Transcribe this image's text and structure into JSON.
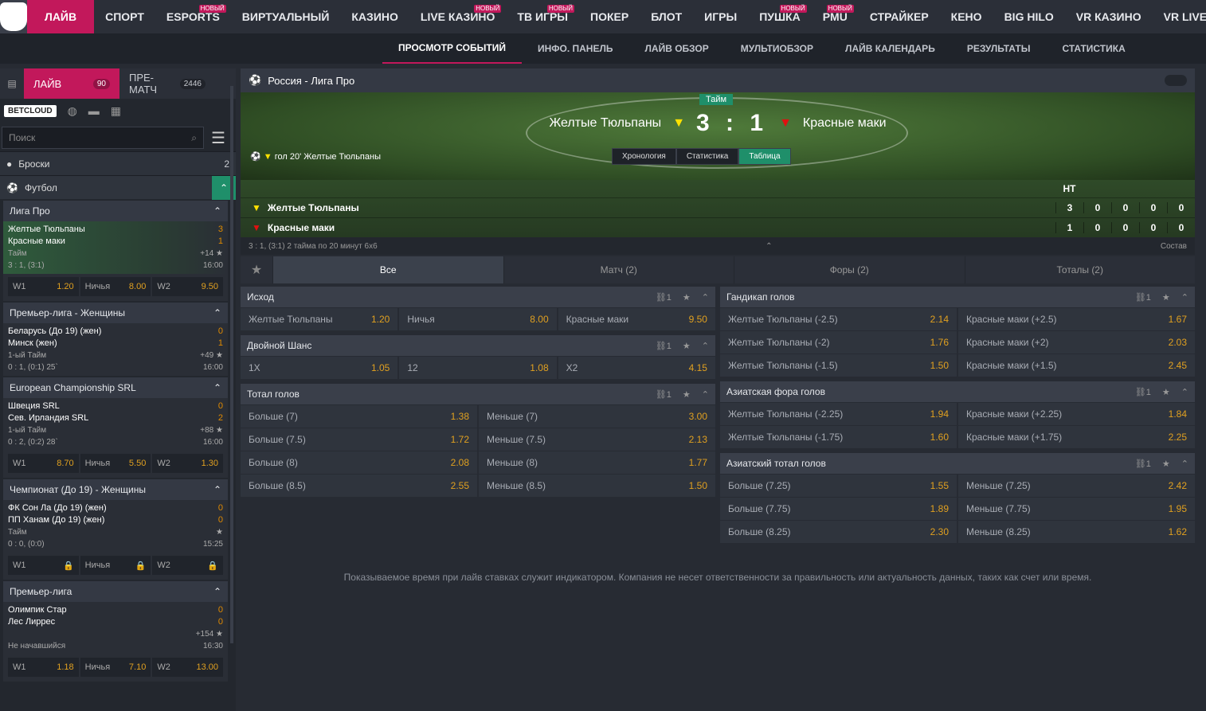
{
  "nav": {
    "items": [
      "ЛАЙВ",
      "СПОРТ",
      "ESPORTS",
      "ВИРТУАЛЬНЫЙ",
      "КАЗИНО",
      "LIVE КАЗИНО",
      "ТВ ИГРЫ",
      "ПОКЕР",
      "БЛОТ",
      "ИГРЫ",
      "ПУШКА",
      "PMU",
      "СТРАЙКЕР",
      "КЕНО",
      "BIG HILO",
      "VR КАЗИНО",
      "VR LIVE"
    ],
    "new_badge": "НОВЫЙ"
  },
  "subnav": {
    "items": [
      "ПРОСМОТР СОБЫТИЙ",
      "ИНФО. ПАНЕЛЬ",
      "ЛАЙВ ОБЗОР",
      "МУЛЬТИОБЗОР",
      "ЛАЙВ КАЛЕНДАРЬ",
      "РЕЗУЛЬТАТЫ",
      "СТАТИСТИКА"
    ]
  },
  "sidebar": {
    "live_label": "ЛАЙВ",
    "live_count": "90",
    "prematch_label": "ПРЕ-МАТЧ",
    "prematch_count": "2446",
    "betcloud": "BETCLOUD",
    "search_placeholder": "Поиск",
    "sports": [
      {
        "name": "Броски",
        "count": "2"
      },
      {
        "name": "Футбол"
      }
    ],
    "leagues": [
      {
        "name": "Лига Про",
        "t1": "Желтые Тюльпаны",
        "s1": "3",
        "t2": "Красные маки",
        "s2": "1",
        "status": "Тайм",
        "extra": "+14",
        "score": "3 : 1, (3:1)",
        "time": "16:00",
        "odds": [
          [
            "W1",
            "1.20"
          ],
          [
            "Ничья",
            "8.00"
          ],
          [
            "W2",
            "9.50"
          ]
        ]
      },
      {
        "name": "Премьер-лига - Женщины",
        "t1": "Беларусь (До 19) (жен)",
        "s1": "0",
        "t2": "Минск (жен)",
        "s2": "1",
        "status": "1-ый Тайм",
        "extra": "+49",
        "score": "0 : 1, (0:1) 25`",
        "time": "16:00"
      },
      {
        "name": "European Championship SRL",
        "t1": "Швеция SRL",
        "s1": "0",
        "t2": "Сев. Ирландия SRL",
        "s2": "2",
        "status": "1-ый Тайм",
        "extra": "+88",
        "score": "0 : 2, (0:2) 28`",
        "time": "16:00",
        "odds": [
          [
            "W1",
            "8.70"
          ],
          [
            "Ничья",
            "5.50"
          ],
          [
            "W2",
            "1.30"
          ]
        ]
      },
      {
        "name": "Чемпионат (До 19) - Женщины",
        "t1": "ФК Сон Ла (До 19) (жен)",
        "s1": "0",
        "t2": "ПП Ханам (До 19) (жен)",
        "s2": "0",
        "status": "Тайм",
        "extra": "",
        "score": "0 : 0, (0:0)",
        "time": "15:25",
        "odds": [
          [
            "W1",
            ""
          ],
          [
            "Ничья",
            ""
          ],
          [
            "W2",
            ""
          ]
        ]
      },
      {
        "name": "Премьер-лига",
        "t1": "Олимпик Стар",
        "s1": "0",
        "t2": "Лес Лиррес",
        "s2": "0",
        "status": "",
        "extra": "+154",
        "score": "Не начавшийся",
        "time": "16:30",
        "odds": [
          [
            "W1",
            "1.18"
          ],
          [
            "Ничья",
            "7.10"
          ],
          [
            "W2",
            "13.00"
          ]
        ]
      }
    ]
  },
  "event": {
    "title": "Россия - Лига Про",
    "half": "Тайм",
    "team1": "Желтые Тюльпаны",
    "team2": "Красные маки",
    "score1": "3",
    "score2": "1",
    "goal_note": "гол 20' Желтые Тюльпаны",
    "tabs": [
      "Хронология",
      "Статистика",
      "Таблица"
    ],
    "stat_cols": [
      "HT",
      "",
      "",
      "",
      ""
    ],
    "rows": [
      {
        "name": "Желтые Тюльпаны",
        "vals": [
          "3",
          "0",
          "0",
          "0",
          "0"
        ]
      },
      {
        "name": "Красные маки",
        "vals": [
          "1",
          "0",
          "0",
          "0",
          "0"
        ]
      }
    ],
    "score_info": "3 : 1, (3:1) 2 тайма по 20 минут 6х6",
    "lineup": "Состав"
  },
  "market_tabs": [
    "Все",
    "Матч (2)",
    "Форы (2)",
    "Тоталы (2)"
  ],
  "markets_left": [
    {
      "title": "Исход",
      "rows": [
        [
          [
            "Желтые Тюльпаны",
            "1.20"
          ],
          [
            "Ничья",
            "8.00"
          ],
          [
            "Красные маки",
            "9.50"
          ]
        ]
      ]
    },
    {
      "title": "Двойной Шанс",
      "rows": [
        [
          [
            "1X",
            "1.05"
          ],
          [
            "12",
            "1.08"
          ],
          [
            "X2",
            "4.15"
          ]
        ]
      ]
    },
    {
      "title": "Тотал голов",
      "rows": [
        [
          [
            "Больше (7)",
            "1.38"
          ],
          [
            "Меньше (7)",
            "3.00"
          ]
        ],
        [
          [
            "Больше (7.5)",
            "1.72"
          ],
          [
            "Меньше (7.5)",
            "2.13"
          ]
        ],
        [
          [
            "Больше (8)",
            "2.08"
          ],
          [
            "Меньше (8)",
            "1.77"
          ]
        ],
        [
          [
            "Больше (8.5)",
            "2.55"
          ],
          [
            "Меньше (8.5)",
            "1.50"
          ]
        ]
      ]
    }
  ],
  "markets_right": [
    {
      "title": "Гандикап голов",
      "rows": [
        [
          [
            "Желтые Тюльпаны (-2.5)",
            "2.14"
          ],
          [
            "Красные маки (+2.5)",
            "1.67"
          ]
        ],
        [
          [
            "Желтые Тюльпаны (-2)",
            "1.76"
          ],
          [
            "Красные маки (+2)",
            "2.03"
          ]
        ],
        [
          [
            "Желтые Тюльпаны (-1.5)",
            "1.50"
          ],
          [
            "Красные маки (+1.5)",
            "2.45"
          ]
        ]
      ]
    },
    {
      "title": "Азиатская фора голов",
      "rows": [
        [
          [
            "Желтые Тюльпаны (-2.25)",
            "1.94"
          ],
          [
            "Красные маки (+2.25)",
            "1.84"
          ]
        ],
        [
          [
            "Желтые Тюльпаны (-1.75)",
            "1.60"
          ],
          [
            "Красные маки (+1.75)",
            "2.25"
          ]
        ]
      ]
    },
    {
      "title": "Азиатский тотал голов",
      "rows": [
        [
          [
            "Больше (7.25)",
            "1.55"
          ],
          [
            "Меньше (7.25)",
            "2.42"
          ]
        ],
        [
          [
            "Больше (7.75)",
            "1.89"
          ],
          [
            "Меньше (7.75)",
            "1.95"
          ]
        ],
        [
          [
            "Больше (8.25)",
            "2.30"
          ],
          [
            "Меньше (8.25)",
            "1.62"
          ]
        ]
      ]
    }
  ],
  "disclaimer": "Показываемое время при лайв ставках служит индикатором. Компания не несет ответственности за правильность или актуальность данных, таких как счет или время."
}
